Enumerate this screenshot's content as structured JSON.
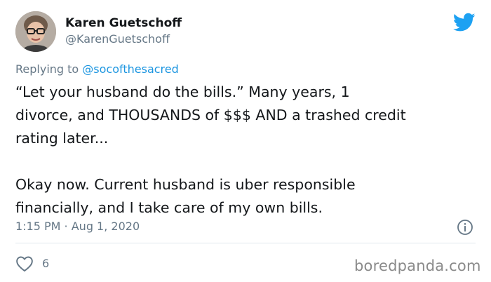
{
  "author": {
    "name": "Karen Guetschoff",
    "handle": "@KarenGuetschoff"
  },
  "reply": {
    "prefix": "Replying to",
    "handle": "@socofthesacred"
  },
  "tweet": {
    "lines": [
      "“Let your husband do the bills.”  Many years, 1",
      "divorce, and THOUSANDS of $$$ AND a trashed credit",
      "rating later...",
      "Okay now. Current husband is uber responsible",
      "financially, and I take care of my own bills."
    ]
  },
  "meta": {
    "timestamp": "1:15 PM · Aug 1, 2020"
  },
  "engagement": {
    "likes": "6"
  },
  "watermark": "boredpanda.com",
  "colors": {
    "twitter_blue": "#1da1f2",
    "link_blue": "#1b95e0",
    "muted_gray": "#657786"
  },
  "icons": {
    "brand": "twitter-bird-icon",
    "info": "info-icon",
    "like": "heart-icon"
  }
}
